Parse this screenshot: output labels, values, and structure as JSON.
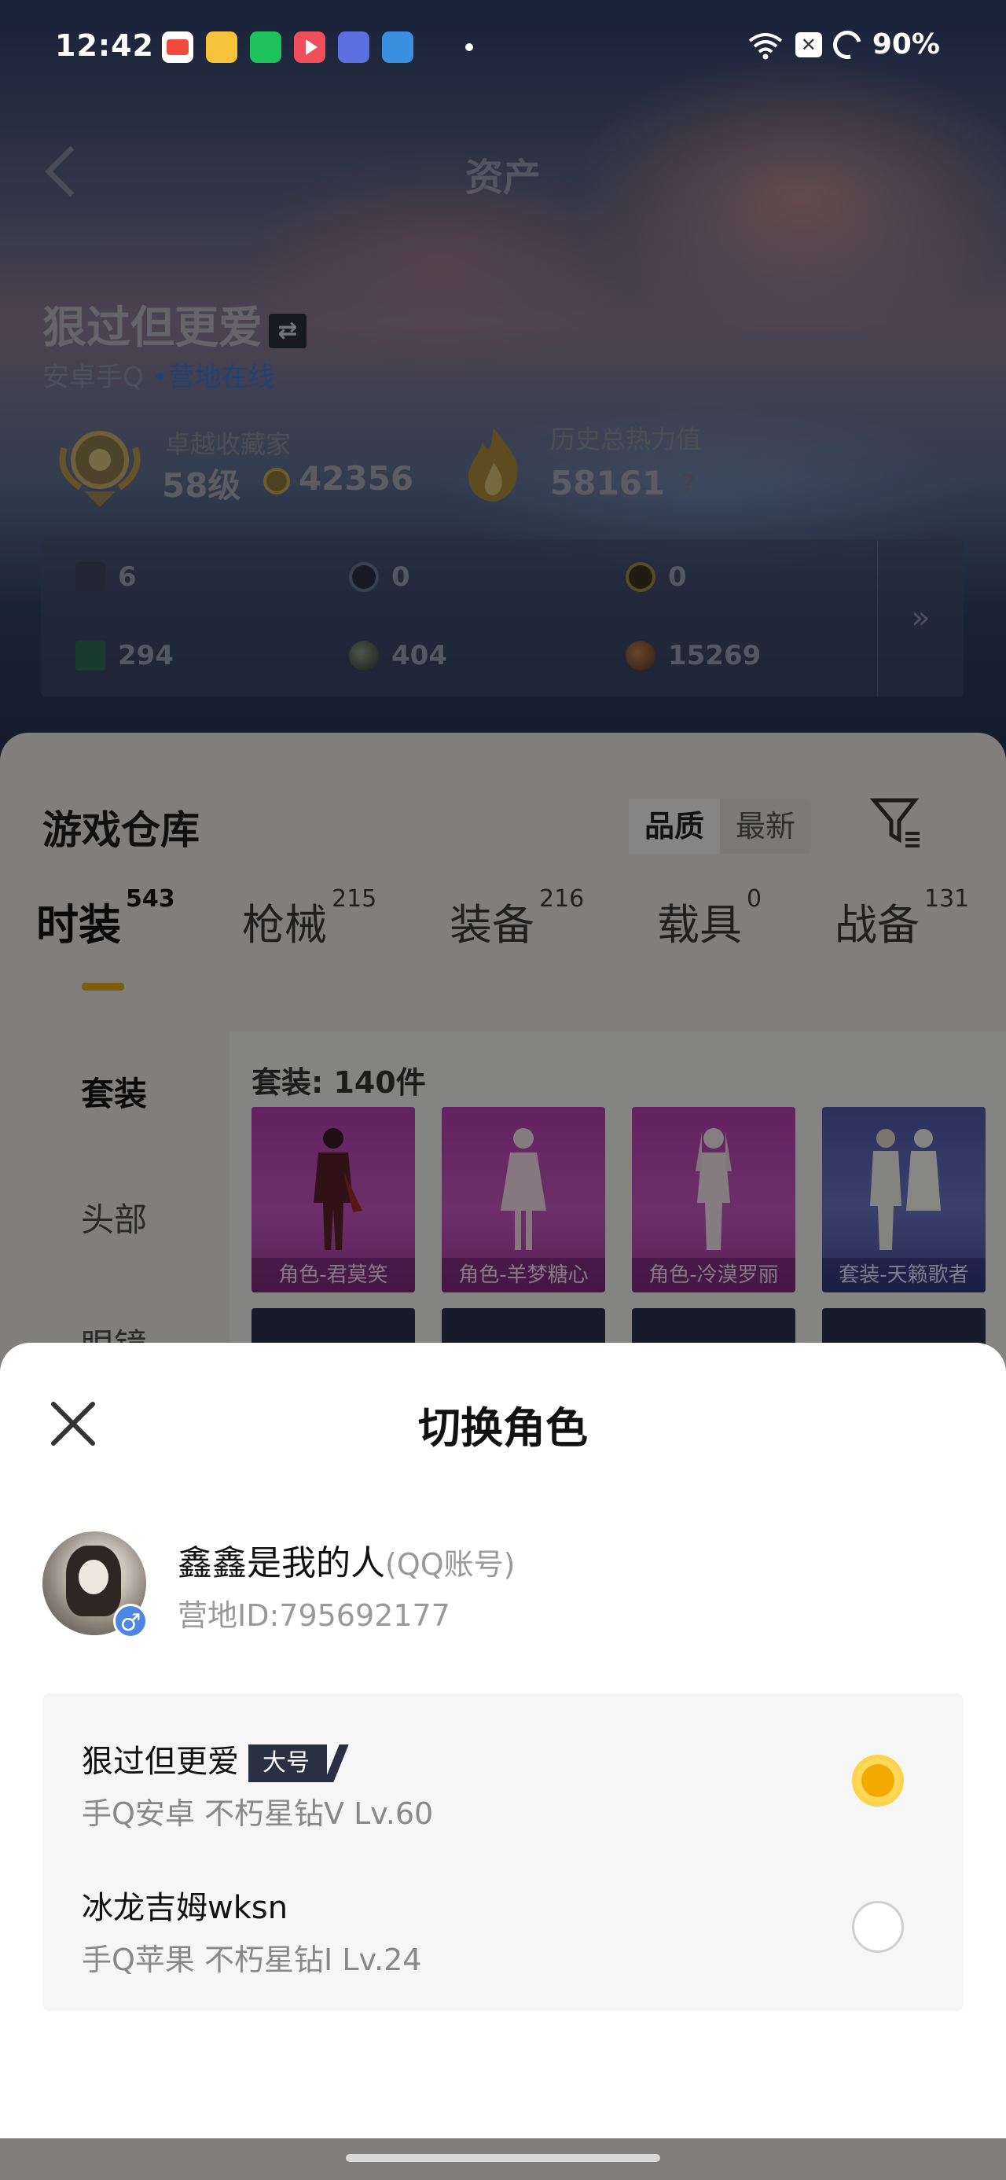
{
  "status_bar": {
    "time": "12:42",
    "battery": "90%",
    "icons": [
      "wifi-icon",
      "xbox-icon",
      "battery-icon"
    ]
  },
  "header": {
    "title": "资产"
  },
  "player": {
    "name": "狠过但更爱",
    "platform": "安卓手Q",
    "status": "营地在线",
    "rank_label": "卓越收藏家",
    "level": "58级",
    "collection_points": "42356",
    "heat_label": "历史总热力值",
    "heat_value": "58161",
    "help": "?"
  },
  "resources": [
    {
      "icon": "card-icon",
      "value": "6"
    },
    {
      "icon": "coin-blue-icon",
      "value": "0"
    },
    {
      "icon": "coin-gold-icon",
      "value": "0"
    },
    {
      "icon": "green-card-icon",
      "value": "294"
    },
    {
      "icon": "green-orb-icon",
      "value": "404"
    },
    {
      "icon": "bronze-coin-icon",
      "value": "15269"
    }
  ],
  "resources_more": "»",
  "warehouse": {
    "title": "游戏仓库",
    "sort_options": [
      "品质",
      "最新"
    ],
    "tabs": [
      {
        "label": "时装",
        "count": "543"
      },
      {
        "label": "枪械",
        "count": "215"
      },
      {
        "label": "装备",
        "count": "216"
      },
      {
        "label": "载具",
        "count": "0"
      },
      {
        "label": "战备",
        "count": "131"
      }
    ],
    "side_categories": [
      "套装",
      "头部",
      "眼镜"
    ],
    "caption": "套装: 140件",
    "items": [
      {
        "label": "角色-君莫笑",
        "rarity": "purple"
      },
      {
        "label": "角色-羊梦糖心",
        "rarity": "purple"
      },
      {
        "label": "角色-冷漠罗丽",
        "rarity": "purple"
      },
      {
        "label": "套装-天籁歌者",
        "rarity": "blue"
      }
    ]
  },
  "modal": {
    "title": "切换角色",
    "account": {
      "name": "鑫鑫是我的人",
      "type": "(QQ账号)",
      "camp_id": "营地ID:795692177",
      "gender": "♂"
    },
    "roles": [
      {
        "name": "狠过但更爱",
        "tag": "大号",
        "meta": "手Q安卓  不朽星钻V  Lv.60",
        "selected": true
      },
      {
        "name": "冰龙吉姆wksn",
        "tag": "",
        "meta": "手Q苹果  不朽星钻I  Lv.24",
        "selected": false
      }
    ]
  },
  "colors": {
    "accent": "#f2a900",
    "tag_bg": "#2a2f44",
    "online": "#3a7ad6"
  }
}
